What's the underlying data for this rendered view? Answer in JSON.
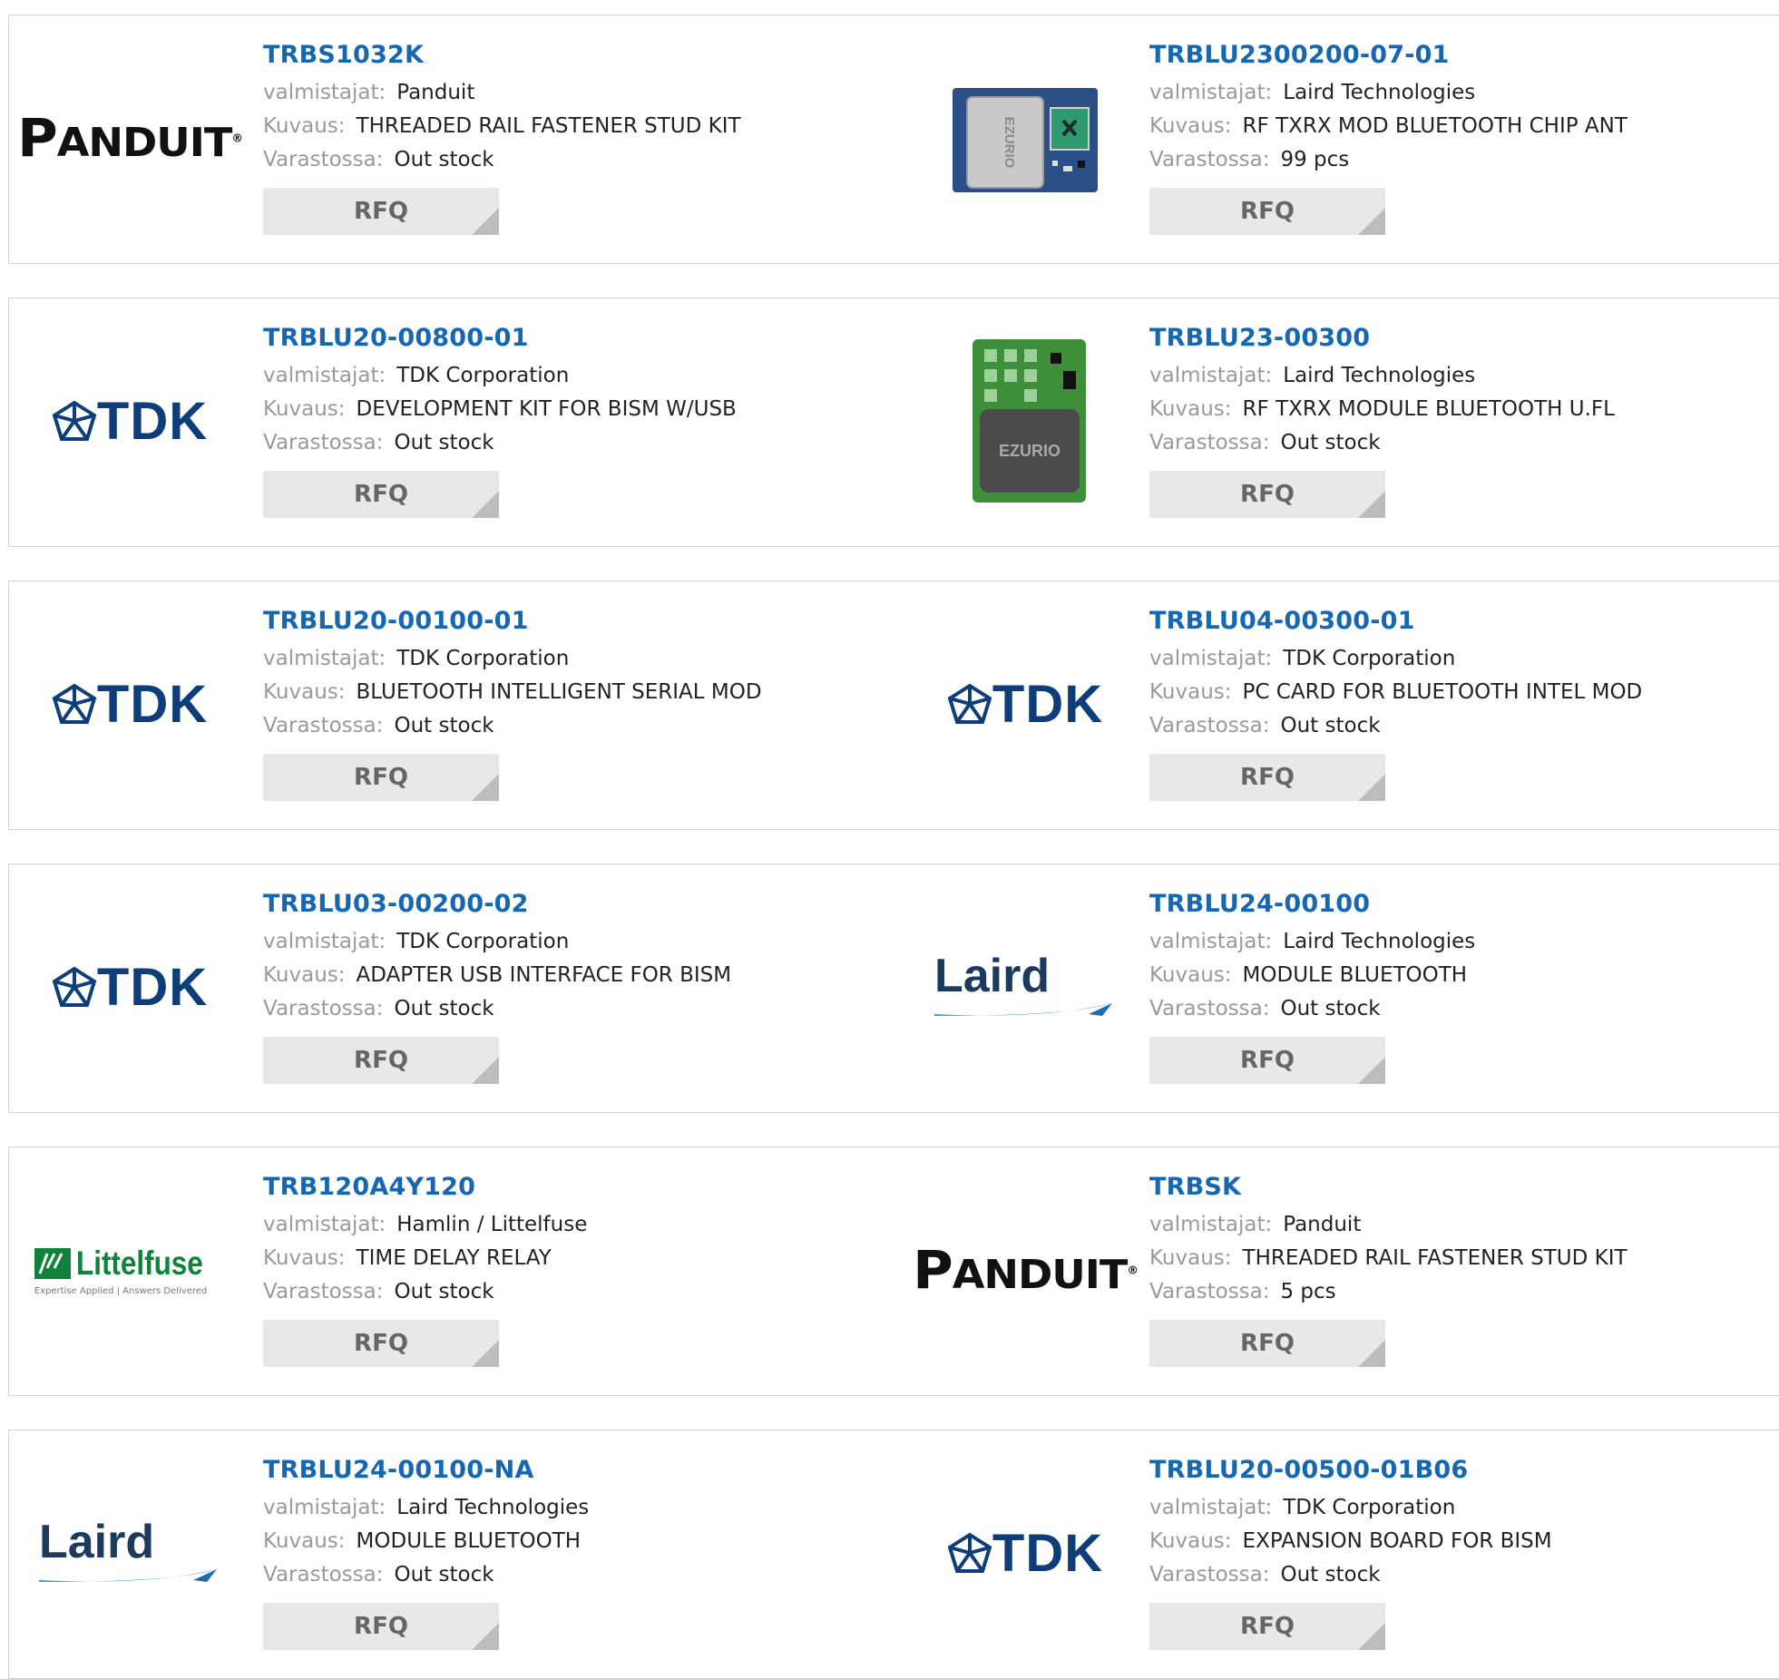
{
  "labels": {
    "manufacturer": "valmistajat:",
    "description": "Kuvaus:",
    "stock": "Varastossa:",
    "rfq": "RFQ"
  },
  "products": [
    {
      "pn": "TRBS1032K",
      "manufacturer": "Panduit",
      "description": "THREADED RAIL FASTENER STUD KIT",
      "stock": "Out stock",
      "logo": "panduit-logo"
    },
    {
      "pn": "TRBLU2300200-07-01",
      "manufacturer": "Laird Technologies",
      "description": "RF TXRX MOD BLUETOOTH CHIP ANT",
      "stock": "99 pcs",
      "logo": "ezurio-blue-module-image",
      "image_text": "EZURIO"
    },
    {
      "pn": "TRBLU20-00800-01",
      "manufacturer": "TDK Corporation",
      "description": "DEVELOPMENT KIT FOR BISM W/USB",
      "stock": "Out stock",
      "logo": "tdk-logo"
    },
    {
      "pn": "TRBLU23-00300",
      "manufacturer": "Laird Technologies",
      "description": "RF TXRX MODULE BLUETOOTH U.FL",
      "stock": "Out stock",
      "logo": "ezurio-green-module-image",
      "image_text": "EZURIO"
    },
    {
      "pn": "TRBLU20-00100-01",
      "manufacturer": "TDK Corporation",
      "description": "BLUETOOTH INTELLIGENT SERIAL MOD",
      "stock": "Out stock",
      "logo": "tdk-logo"
    },
    {
      "pn": "TRBLU04-00300-01",
      "manufacturer": "TDK Corporation",
      "description": "PC CARD FOR BLUETOOTH INTEL MOD",
      "stock": "Out stock",
      "logo": "tdk-logo"
    },
    {
      "pn": "TRBLU03-00200-02",
      "manufacturer": "TDK Corporation",
      "description": "ADAPTER USB INTERFACE FOR BISM",
      "stock": "Out stock",
      "logo": "tdk-logo"
    },
    {
      "pn": "TRBLU24-00100",
      "manufacturer": "Laird Technologies",
      "description": "MODULE BLUETOOTH",
      "stock": "Out stock",
      "logo": "laird-logo"
    },
    {
      "pn": "TRB120A4Y120",
      "manufacturer": "Hamlin / Littelfuse",
      "description": "TIME DELAY RELAY",
      "stock": "Out stock",
      "logo": "littelfuse-logo"
    },
    {
      "pn": "TRBSK",
      "manufacturer": "Panduit",
      "description": "THREADED RAIL FASTENER STUD KIT",
      "stock": "5 pcs",
      "logo": "panduit-logo"
    },
    {
      "pn": "TRBLU24-00100-NA",
      "manufacturer": "Laird Technologies",
      "description": "MODULE BLUETOOTH",
      "stock": "Out stock",
      "logo": "laird-logo"
    },
    {
      "pn": "TRBLU20-00500-01B06",
      "manufacturer": "TDK Corporation",
      "description": "EXPANSION BOARD FOR BISM",
      "stock": "Out stock",
      "logo": "tdk-logo"
    }
  ],
  "logo_text": {
    "panduit": "PANDUIT",
    "tdk": "TDK",
    "laird": "Laird",
    "littelfuse": "Littelfuse",
    "littelfuse_tagline": "Expertise Applied | Answers Delivered"
  },
  "colors": {
    "link": "#1666b0",
    "label": "#9a9a9a",
    "button_bg": "#e8e8e8",
    "border": "#d3d3d3",
    "tdk_blue": "#0d3e79",
    "littelfuse_green": "#11823b"
  }
}
